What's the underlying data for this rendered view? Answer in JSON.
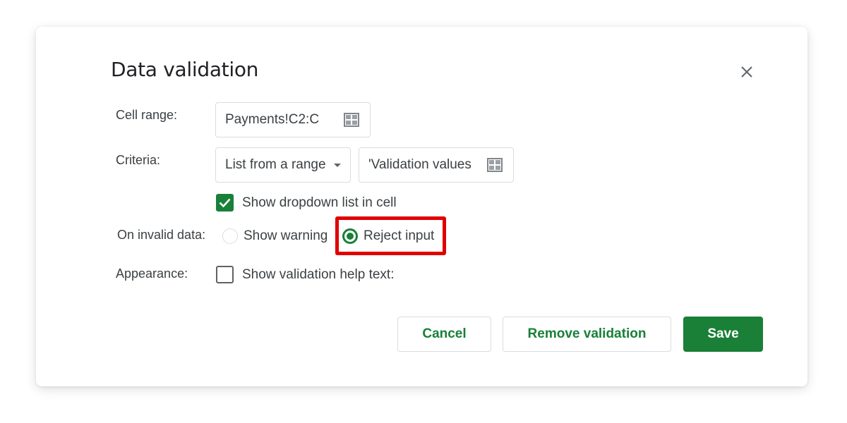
{
  "dialog": {
    "title": "Data validation",
    "close_icon": "close-icon"
  },
  "cell_range": {
    "label": "Cell range:",
    "value": "Payments!C2:C",
    "icon": "grid-select-icon"
  },
  "criteria": {
    "label": "Criteria:",
    "type_selected": "List from a range",
    "range_value": "'Validation values",
    "icon": "grid-select-icon",
    "show_dropdown": {
      "label": "Show dropdown list in cell",
      "checked": true
    }
  },
  "on_invalid": {
    "label": "On invalid data:",
    "options": [
      {
        "label": "Show warning",
        "selected": false
      },
      {
        "label": "Reject input",
        "selected": true
      }
    ],
    "highlight_color": "#e00000"
  },
  "appearance": {
    "label": "Appearance:",
    "help_text": {
      "label": "Show validation help text:",
      "checked": false
    }
  },
  "buttons": {
    "cancel": "Cancel",
    "remove": "Remove validation",
    "save": "Save"
  },
  "colors": {
    "accent": "#188038",
    "primary_button": "#1a7f37"
  }
}
